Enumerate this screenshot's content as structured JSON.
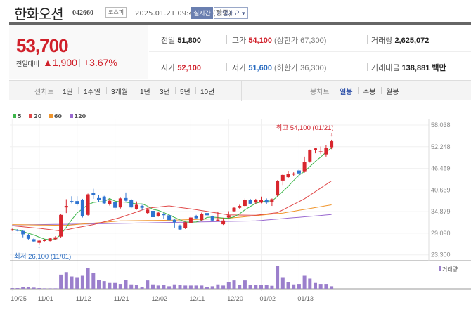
{
  "header": {
    "title": "한화오션",
    "code": "042660",
    "market": "코스피",
    "datetime": "2025.01.21 09:42 기준(장중)",
    "realtime": "실시간",
    "overview": "기업개요 ▾"
  },
  "price": {
    "current": "53,700",
    "change_label": "전일대비",
    "change": "▲1,900",
    "change_pct": "+3.67%"
  },
  "info": {
    "prev_label": "전일",
    "prev": "51,800",
    "high_label": "고가",
    "high": "54,100",
    "upper_limit": "(상한가 67,300)",
    "volume_label": "거래량",
    "volume": "2,625,072",
    "open_label": "시가",
    "open": "52,100",
    "low_label": "저가",
    "low": "51,600",
    "lower_limit": "(하한가 36,300)",
    "amount_label": "거래대금",
    "amount": "138,881",
    "amount_unit": "백만"
  },
  "tabs": {
    "line_label": "선차트",
    "line": [
      "1일",
      "1주일",
      "3개월",
      "1년",
      "3년",
      "5년",
      "10년"
    ],
    "candle_label": "봉차트",
    "candle": [
      "일봉",
      "주봉",
      "월봉"
    ],
    "candle_selected": 0
  },
  "legend": [
    {
      "label": "5",
      "color": "#3cb64a"
    },
    {
      "label": "20",
      "color": "#e04848"
    },
    {
      "label": "60",
      "color": "#f0952c"
    },
    {
      "label": "120",
      "color": "#9a6ad0"
    }
  ],
  "chart_data": {
    "type": "candlestick",
    "y_ticks": [
      "58,038",
      "52,248",
      "46,459",
      "40,669",
      "34,879",
      "29,090",
      "23,300"
    ],
    "ylim": [
      23300,
      58038
    ],
    "x_labels": [
      {
        "idx": 0,
        "label": "10/25"
      },
      {
        "idx": 5,
        "label": "11/01"
      },
      {
        "idx": 12,
        "label": "11/12"
      },
      {
        "idx": 19,
        "label": "11/21"
      },
      {
        "idx": 26,
        "label": "12/02"
      },
      {
        "idx": 33,
        "label": "12/11"
      },
      {
        "idx": 40,
        "label": "12/20"
      },
      {
        "idx": 46,
        "label": "01/02"
      },
      {
        "idx": 53,
        "label": "01/13"
      }
    ],
    "max_annotation": "최고 54,100 (01/21)",
    "min_annotation": "최저 26,100 (11/01)",
    "volume_label": "거래량",
    "candles": [
      [
        29900,
        30100,
        30300,
        29700
      ],
      [
        30000,
        29800,
        30200,
        29600
      ],
      [
        29700,
        28800,
        29900,
        28000
      ],
      [
        28700,
        27600,
        28900,
        27400
      ],
      [
        27500,
        26900,
        27700,
        26700
      ],
      [
        26500,
        27100,
        27300,
        26100
      ],
      [
        27100,
        27300,
        27500,
        26900
      ],
      [
        27000,
        27700,
        27900,
        26900
      ],
      [
        27500,
        28000,
        28300,
        27300
      ],
      [
        28200,
        34000,
        34200,
        27900
      ],
      [
        36000,
        36400,
        38200,
        34500
      ],
      [
        37700,
        37400,
        39000,
        37100
      ],
      [
        37700,
        36800,
        39000,
        36500
      ],
      [
        38000,
        33600,
        38300,
        33300
      ],
      [
        34000,
        39500,
        39700,
        33800
      ],
      [
        39800,
        39400,
        41000,
        38300
      ],
      [
        38500,
        38100,
        39300,
        37500
      ],
      [
        38900,
        37100,
        39100,
        36900
      ],
      [
        36900,
        37800,
        38300,
        36500
      ],
      [
        37400,
        35900,
        37600,
        35300
      ],
      [
        36000,
        38400,
        38600,
        35700
      ],
      [
        38500,
        37800,
        40000,
        37600
      ],
      [
        38100,
        36000,
        38300,
        35800
      ],
      [
        35600,
        36700,
        37600,
        35400
      ],
      [
        36400,
        35900,
        36700,
        35300
      ],
      [
        34500,
        35400,
        35700,
        34200
      ],
      [
        35100,
        33400,
        35300,
        33200
      ],
      [
        33700,
        34600,
        34800,
        33500
      ],
      [
        34200,
        34000,
        34600,
        32900
      ],
      [
        33900,
        32600,
        34100,
        32400
      ],
      [
        32700,
        32000,
        32900,
        30600
      ],
      [
        31200,
        30100,
        31400,
        30000
      ],
      [
        30400,
        32000,
        32200,
        30200
      ],
      [
        31900,
        33300,
        33500,
        31700
      ],
      [
        33700,
        33100,
        34000,
        32900
      ],
      [
        32600,
        34300,
        34600,
        32400
      ],
      [
        34500,
        33900,
        34800,
        33700
      ],
      [
        33600,
        32500,
        33800,
        32300
      ],
      [
        32500,
        32700,
        34800,
        32300
      ],
      [
        31500,
        32500,
        33200,
        31300
      ],
      [
        33300,
        33900,
        35000,
        33100
      ],
      [
        35000,
        35900,
        36200,
        34800
      ],
      [
        35900,
        36400,
        36700,
        35700
      ],
      [
        36400,
        38100,
        38400,
        36200
      ],
      [
        38000,
        37000,
        38300,
        36800
      ],
      [
        37300,
        38000,
        38300,
        37000
      ],
      [
        37300,
        38100,
        38900,
        37100
      ],
      [
        38100,
        37300,
        38400,
        36900
      ],
      [
        37400,
        38200,
        38400,
        36400
      ],
      [
        39200,
        43100,
        43300,
        39000
      ],
      [
        43200,
        44700,
        45000,
        42000
      ],
      [
        44100,
        45000,
        45700,
        43800
      ],
      [
        44800,
        45100,
        45400,
        44500
      ],
      [
        45900,
        45100,
        46300,
        43900
      ],
      [
        45500,
        48200,
        49600,
        45300
      ],
      [
        48300,
        51300,
        51500,
        48000
      ],
      [
        51300,
        51800,
        52000,
        50500
      ],
      [
        50800,
        51000,
        52300,
        50300
      ],
      [
        50200,
        51900,
        52600,
        49600
      ],
      [
        52100,
        53700,
        54100,
        51600
      ]
    ],
    "volume": [
      3,
      3,
      8,
      8,
      5,
      3,
      2,
      2,
      2,
      61,
      72,
      53,
      50,
      56,
      90,
      67,
      39,
      33,
      25,
      25,
      21,
      39,
      19,
      16,
      9,
      36,
      19,
      14,
      16,
      11,
      19,
      16,
      14,
      14,
      14,
      14,
      9,
      11,
      19,
      14,
      28,
      36,
      16,
      36,
      16,
      16,
      16,
      16,
      13,
      100,
      50,
      30,
      19,
      21,
      56,
      44,
      25,
      21,
      21,
      11
    ],
    "ma20": [
      [
        0,
        31100
      ],
      [
        5,
        30400
      ],
      [
        9,
        29700
      ],
      [
        12,
        30600
      ],
      [
        15,
        31400
      ],
      [
        20,
        33300
      ],
      [
        25,
        35800
      ],
      [
        29,
        36400
      ],
      [
        34,
        35400
      ],
      [
        40,
        34000
      ],
      [
        45,
        33900
      ],
      [
        49,
        34600
      ],
      [
        54,
        38300
      ],
      [
        59,
        43100
      ]
    ],
    "ma60": [
      [
        0,
        31400
      ],
      [
        10,
        31200
      ],
      [
        20,
        32400
      ],
      [
        30,
        32600
      ],
      [
        40,
        33100
      ],
      [
        50,
        34500
      ],
      [
        59,
        36700
      ]
    ],
    "ma120": [
      [
        0,
        31300
      ],
      [
        15,
        31600
      ],
      [
        30,
        32000
      ],
      [
        45,
        32400
      ],
      [
        59,
        34100
      ]
    ]
  }
}
